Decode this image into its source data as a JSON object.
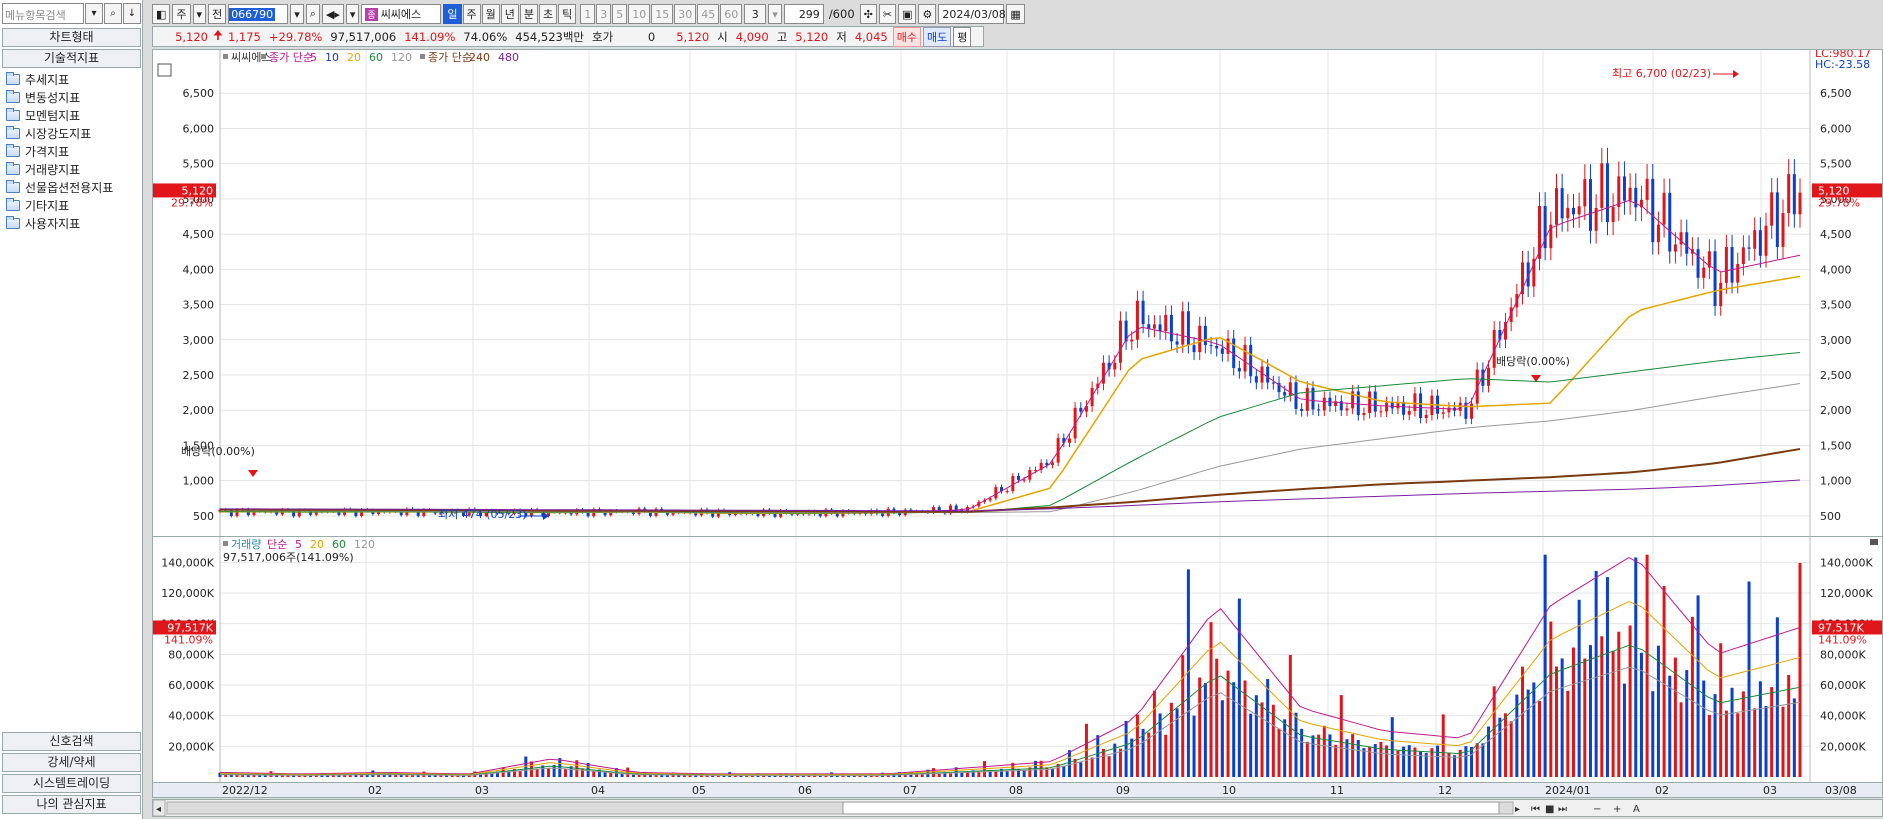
{
  "left_panel": {
    "search_placeholder": "메뉴항목검색",
    "header_chart_type": "차트형태",
    "header_technical": "기술적지표",
    "tree_items": [
      "추세지표",
      "변동성지표",
      "모멘텀지표",
      "시장강도지표",
      "가격지표",
      "거래량지표",
      "선물옵션전용지표",
      "기타지표",
      "사용자지표"
    ],
    "bottom_buttons": [
      "신호검색",
      "강세/약세",
      "시스템트레이딩",
      "나의 관심지표"
    ]
  },
  "toolbar1": {
    "unit_label": "주",
    "mode_label": "전",
    "stock_code": "066790",
    "stock_name": "씨씨에스",
    "period_tabs": [
      "일",
      "주",
      "월",
      "년",
      "분",
      "초",
      "틱"
    ],
    "active_period": "일",
    "interval_buttons": [
      "1",
      "3",
      "5",
      "10",
      "15",
      "30",
      "45",
      "60"
    ],
    "interval_select": "3",
    "count": "299",
    "count_total": "/600",
    "date": "2024/03/08"
  },
  "toolbar2": {
    "price": "5,120",
    "change": "1,175",
    "change_pct": "+29.78%",
    "volume": "97,517,006",
    "vol_ratio": "141.09%",
    "turnover": "74.06%",
    "amount": "454,523백만",
    "hoga_label": "호가",
    "hoga_value": "0",
    "hoga_price": "5,120",
    "open_label": "시",
    "open": "4,090",
    "high_label": "고",
    "high": "5,120",
    "low_label": "저",
    "low": "4,045",
    "buy": "매수",
    "sell": "매도",
    "eval": "평"
  },
  "price_legend": {
    "name": "씨씨에스",
    "ma_label": "종가 단순",
    "ma_periods": [
      "5",
      "10",
      "20",
      "60",
      "120"
    ],
    "ma2_label": "종가 단순",
    "ma2_periods": [
      "240",
      "480"
    ]
  },
  "vol_legend": {
    "label": "거래량",
    "ma_label": "단순",
    "periods": [
      "5",
      "20",
      "60",
      "120"
    ],
    "info": "97,517,006주(141.09%)"
  },
  "annotations": {
    "high_label": "최고 6,700 (02/23)",
    "low_label": "최저 474 (05/23)",
    "dividend1": "배당락(0.00%)",
    "dividend2": "배당락(0.00%)",
    "lc": "LC:980.17",
    "hc": "HC:-23.58",
    "price_tag": "5,120",
    "price_pct": "29.78%",
    "vol_tag": "97,517K",
    "vol_pct": "141.09%"
  },
  "x_labels": [
    "2022/12",
    "02",
    "03",
    "04",
    "05",
    "06",
    "07",
    "08",
    "09",
    "10",
    "11",
    "12",
    "2024/01",
    "02",
    "03"
  ],
  "x_last": "03/08",
  "colors": {
    "up": "#e0161b",
    "down": "#0a3fd0",
    "ma5": "#c0198c",
    "ma10": "#1f3fa5",
    "ma20": "#e3a600",
    "ma60": "#1b8a3a",
    "ma120": "#999999",
    "ma240": "#7a3b10",
    "ma480": "#7a1fa2"
  },
  "chart_data": [
    {
      "type": "candlestick",
      "title": "씨씨에스",
      "ylim": [
        300,
        7000
      ],
      "y_ticks": [
        500,
        1000,
        1500,
        2000,
        2500,
        3000,
        3500,
        4000,
        4500,
        5000,
        5500,
        6000,
        6500
      ],
      "x": [
        "2022/12",
        "02",
        "03",
        "04",
        "05",
        "06",
        "07",
        "08",
        "09",
        "10",
        "11",
        "12",
        "2024/01",
        "02",
        "03"
      ],
      "series": [
        {
          "name": "종가",
          "values": [
            560,
            555,
            560,
            555,
            545,
            560,
            540,
            535,
            545,
            600,
            1300,
            3300,
            2900,
            2100,
            2050,
            2000,
            4800,
            5100,
            3800,
            5120
          ]
        },
        {
          "name": "5",
          "values": [
            560,
            556,
            558,
            555,
            548,
            556,
            540,
            536,
            545,
            590,
            1250,
            3200,
            2950,
            2150,
            2060,
            2010,
            4600,
            5000,
            3950,
            4200
          ]
        },
        {
          "name": "20",
          "values": [
            560,
            556,
            558,
            555,
            548,
            556,
            540,
            536,
            545,
            560,
            900,
            2700,
            3050,
            2400,
            2120,
            2050,
            2100,
            3400,
            3700,
            3900
          ]
        },
        {
          "name": "60",
          "values": [
            560,
            556,
            558,
            555,
            550,
            556,
            545,
            540,
            545,
            550,
            650,
            1300,
            1900,
            2250,
            2350,
            2450,
            2400,
            2550,
            2700,
            2820
          ]
        },
        {
          "name": "120",
          "values": [
            580,
            575,
            570,
            565,
            560,
            560,
            555,
            550,
            548,
            548,
            560,
            850,
            1200,
            1450,
            1600,
            1750,
            1850,
            2000,
            2200,
            2380
          ]
        },
        {
          "name": "240",
          "values": [
            590,
            588,
            585,
            580,
            575,
            572,
            568,
            565,
            560,
            560,
            620,
            700,
            800,
            880,
            950,
            1000,
            1050,
            1120,
            1250,
            1450
          ]
        },
        {
          "name": "480",
          "values": [
            600,
            598,
            595,
            592,
            588,
            585,
            582,
            578,
            575,
            570,
            600,
            650,
            700,
            740,
            780,
            820,
            850,
            880,
            930,
            1010
          ]
        }
      ]
    },
    {
      "type": "bar",
      "title": "거래량",
      "ylim": [
        0,
        150000
      ],
      "y_ticks": [
        20000,
        40000,
        60000,
        80000,
        100000,
        120000,
        140000
      ],
      "values_k": [
        3,
        2,
        3,
        2,
        12,
        3,
        2,
        2,
        2,
        6,
        10,
        38,
        112,
        45,
        30,
        25,
        112,
        145,
        80,
        97.517
      ]
    }
  ]
}
